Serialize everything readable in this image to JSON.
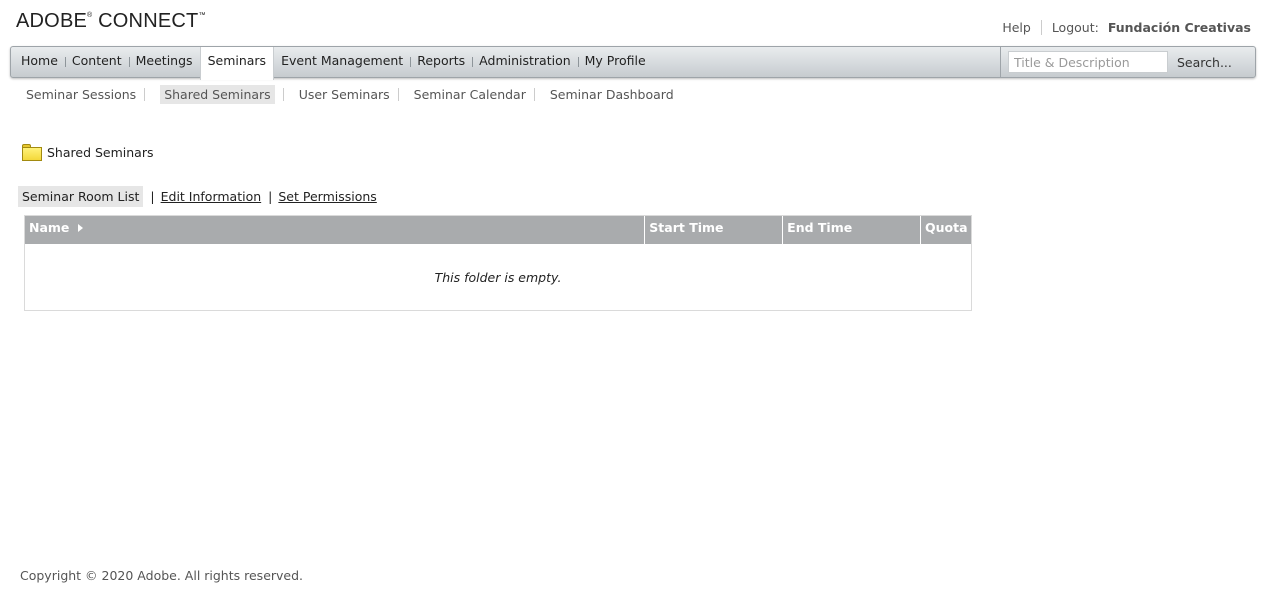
{
  "brand": {
    "name": "ADOBE",
    "reg": "®",
    "product": "CONNECT",
    "tm": "™"
  },
  "toplinks": {
    "help": "Help",
    "logout": "Logout:",
    "user": "Fundación Creativas"
  },
  "nav": {
    "tabs": [
      "Home",
      "Content",
      "Meetings",
      "Seminars",
      "Event Management",
      "Reports",
      "Administration",
      "My Profile"
    ],
    "active": "Seminars"
  },
  "search": {
    "placeholder": "Title & Description",
    "button": "Search..."
  },
  "subnav": {
    "items": [
      "Seminar Sessions",
      "Shared Seminars",
      "User Seminars",
      "Seminar Calendar",
      "Seminar Dashboard"
    ],
    "active": "Shared Seminars"
  },
  "folder": {
    "label": "Shared Seminars"
  },
  "actions": {
    "active": "Seminar Room List",
    "sep": "|",
    "edit": "Edit Information",
    "perms": "Set Permissions"
  },
  "table": {
    "columns": [
      "Name",
      "Start Time",
      "End Time",
      "Quota"
    ],
    "empty": "This folder is empty."
  },
  "footer": {
    "copyright": "Copyright © 2020 Adobe. All rights reserved."
  }
}
